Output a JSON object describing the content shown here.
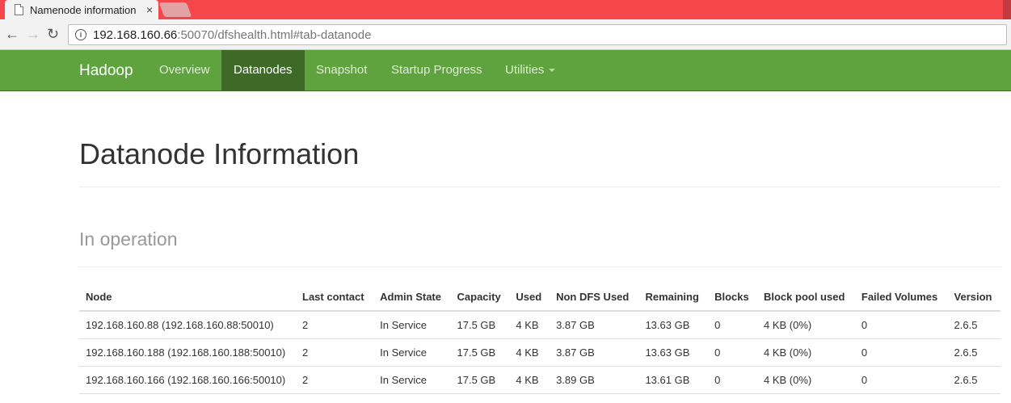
{
  "browser": {
    "tab_title": "Namenode information",
    "tab_close": "×",
    "url_host": "192.168.160.66",
    "url_rest": ":50070/dfshealth.html#tab-datanode",
    "back_glyph": "←",
    "forward_glyph": "→",
    "reload_glyph": "↻",
    "info_glyph": "i"
  },
  "navbar": {
    "brand": "Hadoop",
    "items": [
      {
        "label": "Overview"
      },
      {
        "label": "Datanodes"
      },
      {
        "label": "Snapshot"
      },
      {
        "label": "Startup Progress"
      },
      {
        "label": "Utilities"
      }
    ]
  },
  "page": {
    "title": "Datanode Information",
    "section": "In operation"
  },
  "table": {
    "headers": [
      "Node",
      "Last contact",
      "Admin State",
      "Capacity",
      "Used",
      "Non DFS Used",
      "Remaining",
      "Blocks",
      "Block pool used",
      "Failed Volumes",
      "Version"
    ],
    "rows": [
      [
        "192.168.160.88 (192.168.160.88:50010)",
        "2",
        "In Service",
        "17.5 GB",
        "4 KB",
        "3.87 GB",
        "13.63 GB",
        "0",
        "4 KB (0%)",
        "0",
        "2.6.5"
      ],
      [
        "192.168.160.188 (192.168.160.188:50010)",
        "2",
        "In Service",
        "17.5 GB",
        "4 KB",
        "3.87 GB",
        "13.63 GB",
        "0",
        "4 KB (0%)",
        "0",
        "2.6.5"
      ],
      [
        "192.168.160.166 (192.168.160.166:50010)",
        "2",
        "In Service",
        "17.5 GB",
        "4 KB",
        "3.89 GB",
        "13.61 GB",
        "0",
        "4 KB (0%)",
        "0",
        "2.6.5"
      ]
    ]
  }
}
